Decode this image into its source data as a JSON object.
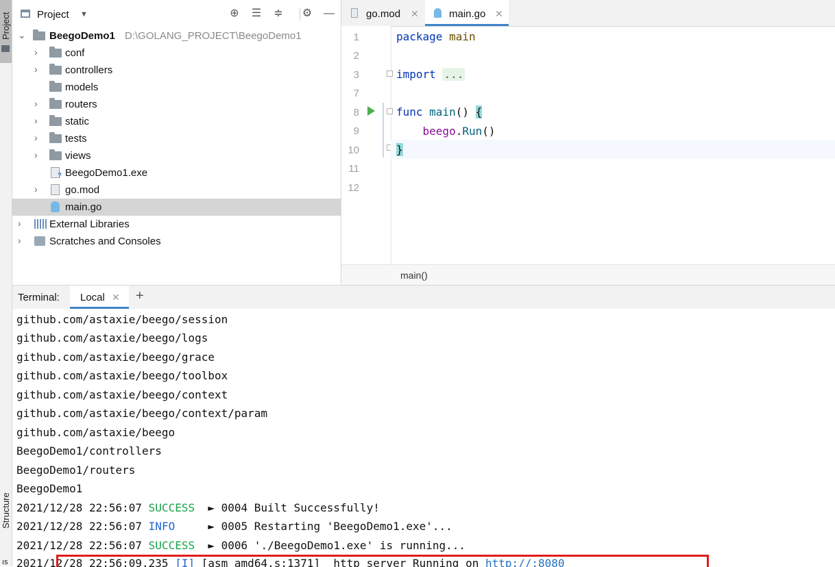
{
  "sidebar": {
    "project_tab": "Project",
    "structure_tab": "Structure",
    "bottom_tab": "ıs"
  },
  "project_panel": {
    "title": "Project",
    "header_icons": [
      "locate-icon",
      "expand-all-icon",
      "collapse-all-icon",
      "gear-icon",
      "minimize-icon"
    ],
    "root": {
      "name": "BeegoDemo1",
      "path": "D:\\GOLANG_PROJECT\\BeegoDemo1"
    },
    "items": [
      {
        "label": "conf",
        "type": "folder",
        "expandable": true
      },
      {
        "label": "controllers",
        "type": "folder",
        "expandable": true
      },
      {
        "label": "models",
        "type": "folder",
        "expandable": false
      },
      {
        "label": "routers",
        "type": "folder",
        "expandable": true
      },
      {
        "label": "static",
        "type": "folder",
        "expandable": true
      },
      {
        "label": "tests",
        "type": "folder",
        "expandable": true
      },
      {
        "label": "views",
        "type": "folder",
        "expandable": true
      },
      {
        "label": "BeegoDemo1.exe",
        "type": "exe",
        "expandable": false
      },
      {
        "label": "go.mod",
        "type": "file",
        "expandable": true
      },
      {
        "label": "main.go",
        "type": "go",
        "expandable": false,
        "selected": true
      }
    ],
    "external_libraries": "External Libraries",
    "scratches": "Scratches and Consoles"
  },
  "editor": {
    "tabs": [
      {
        "label": "go.mod",
        "active": false
      },
      {
        "label": "main.go",
        "active": true
      }
    ],
    "line_numbers": [
      "1",
      "2",
      "3",
      "7",
      "8",
      "9",
      "10",
      "11",
      "12"
    ],
    "code": {
      "l1_kw": "package",
      "l1_name": "main",
      "l3_kw": "import",
      "l3_folded": "...",
      "l8_kw": "func",
      "l8_name": "main",
      "l8_parens": "()",
      "l8_brace": "{",
      "l9_pkg": "beego",
      "l9_dot": ".",
      "l9_call": "Run",
      "l9_parens": "()",
      "l10_brace": "}"
    },
    "breadcrumb": "main()",
    "current_line": "10"
  },
  "terminal": {
    "title": "Terminal:",
    "tab_label": "Local",
    "add_label": "+",
    "lines": [
      "github.com/astaxie/beego/session",
      "github.com/astaxie/beego/logs",
      "github.com/astaxie/beego/grace",
      "github.com/astaxie/beego/toolbox",
      "github.com/astaxie/beego/context",
      "github.com/astaxie/beego/context/param",
      "github.com/astaxie/beego",
      "BeegoDemo1/controllers",
      "BeegoDemo1/routers",
      "BeegoDemo1"
    ],
    "log": [
      {
        "time": "2021/12/28 22:56:07",
        "level": "SUCCESS",
        "pad": "  ",
        "msg": "► 0004 Built Successfully!"
      },
      {
        "time": "2021/12/28 22:56:07",
        "level": "INFO",
        "pad": "     ",
        "msg": "► 0005 Restarting 'BeegoDemo1.exe'..."
      },
      {
        "time": "2021/12/28 22:56:07",
        "level": "SUCCESS",
        "pad": "  ",
        "msg": "► 0006 './BeegoDemo1.exe' is running..."
      }
    ],
    "last_line": {
      "time": "2021/12/28 22:56:09.235",
      "tag": "[I]",
      "source": "[asm_amd64.s:1371]",
      "msg": "http server Running on",
      "url": "http://:8080"
    },
    "colors": {
      "success": "#16a34a",
      "info": "#2463d6",
      "highlight": "#e01b1b"
    }
  }
}
